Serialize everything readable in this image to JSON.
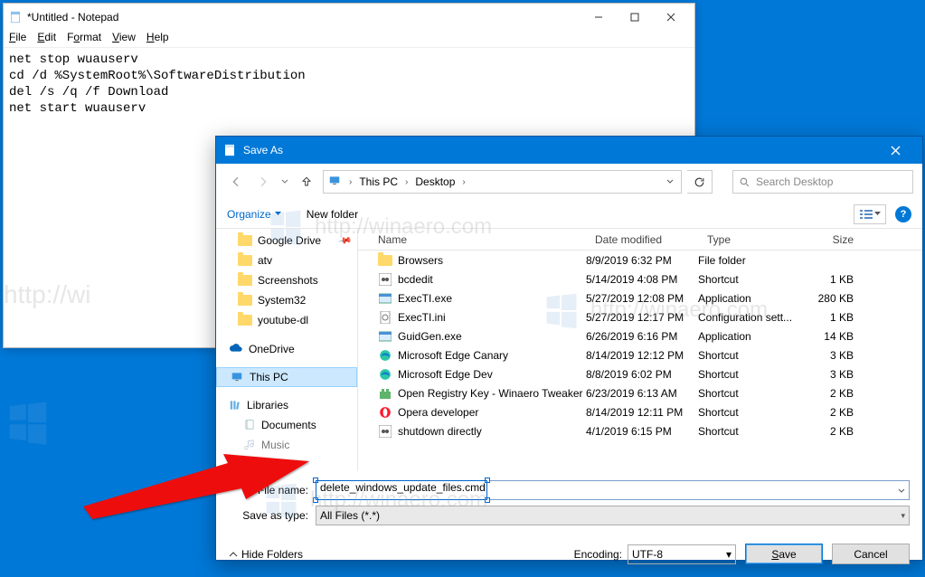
{
  "notepad": {
    "title": "*Untitled - Notepad",
    "menu": {
      "file": "File",
      "edit": "Edit",
      "format": "Format",
      "view": "View",
      "help": "Help"
    },
    "body": "net stop wuauserv\ncd /d %SystemRoot%\\SoftwareDistribution\ndel /s /q /f Download\nnet start wuauserv"
  },
  "saveas": {
    "title": "Save As",
    "breadcrumb": {
      "root": "This PC",
      "folder": "Desktop"
    },
    "search_placeholder": "Search Desktop",
    "toolbar": {
      "organize": "Organize",
      "newfolder": "New folder"
    },
    "tree": {
      "items": [
        {
          "label": "Google Drive",
          "pinned": true
        },
        {
          "label": "atv"
        },
        {
          "label": "Screenshots"
        },
        {
          "label": "System32"
        },
        {
          "label": "youtube-dl"
        }
      ],
      "onedrive": "OneDrive",
      "thispc": "This PC",
      "libraries": "Libraries",
      "documents": "Documents",
      "music": "Music"
    },
    "columns": {
      "name": "Name",
      "date": "Date modified",
      "type": "Type",
      "size": "Size"
    },
    "rows": [
      {
        "icon": "folder",
        "name": "Browsers",
        "date": "8/9/2019 6:32 PM",
        "type": "File folder",
        "size": ""
      },
      {
        "icon": "bat",
        "name": "bcdedit",
        "date": "5/14/2019 4:08 PM",
        "type": "Shortcut",
        "size": "1 KB"
      },
      {
        "icon": "exe",
        "name": "ExecTI.exe",
        "date": "5/27/2019 12:08 PM",
        "type": "Application",
        "size": "280 KB"
      },
      {
        "icon": "ini",
        "name": "ExecTI.ini",
        "date": "5/27/2019 12:17 PM",
        "type": "Configuration sett...",
        "size": "1 KB"
      },
      {
        "icon": "exe",
        "name": "GuidGen.exe",
        "date": "6/26/2019 6:16 PM",
        "type": "Application",
        "size": "14 KB"
      },
      {
        "icon": "edge",
        "name": "Microsoft Edge Canary",
        "date": "8/14/2019 12:12 PM",
        "type": "Shortcut",
        "size": "3 KB"
      },
      {
        "icon": "edge",
        "name": "Microsoft Edge Dev",
        "date": "8/8/2019 6:02 PM",
        "type": "Shortcut",
        "size": "3 KB"
      },
      {
        "icon": "reg",
        "name": "Open Registry Key - Winaero Tweaker",
        "date": "6/23/2019 6:13 AM",
        "type": "Shortcut",
        "size": "2 KB"
      },
      {
        "icon": "opera",
        "name": "Opera developer",
        "date": "8/14/2019 12:11 PM",
        "type": "Shortcut",
        "size": "2 KB"
      },
      {
        "icon": "bat",
        "name": "shutdown directly",
        "date": "4/1/2019 6:15 PM",
        "type": "Shortcut",
        "size": "2 KB"
      }
    ],
    "filename_label": "File name:",
    "filename_value": "delete_windows_update_files.cmd",
    "saveastype_label": "Save as type:",
    "saveastype_value": "All Files  (*.*)",
    "hide_folders": "Hide Folders",
    "encoding_label": "Encoding:",
    "encoding_value": "UTF-8",
    "save_btn": "Save",
    "cancel_btn": "Cancel"
  }
}
